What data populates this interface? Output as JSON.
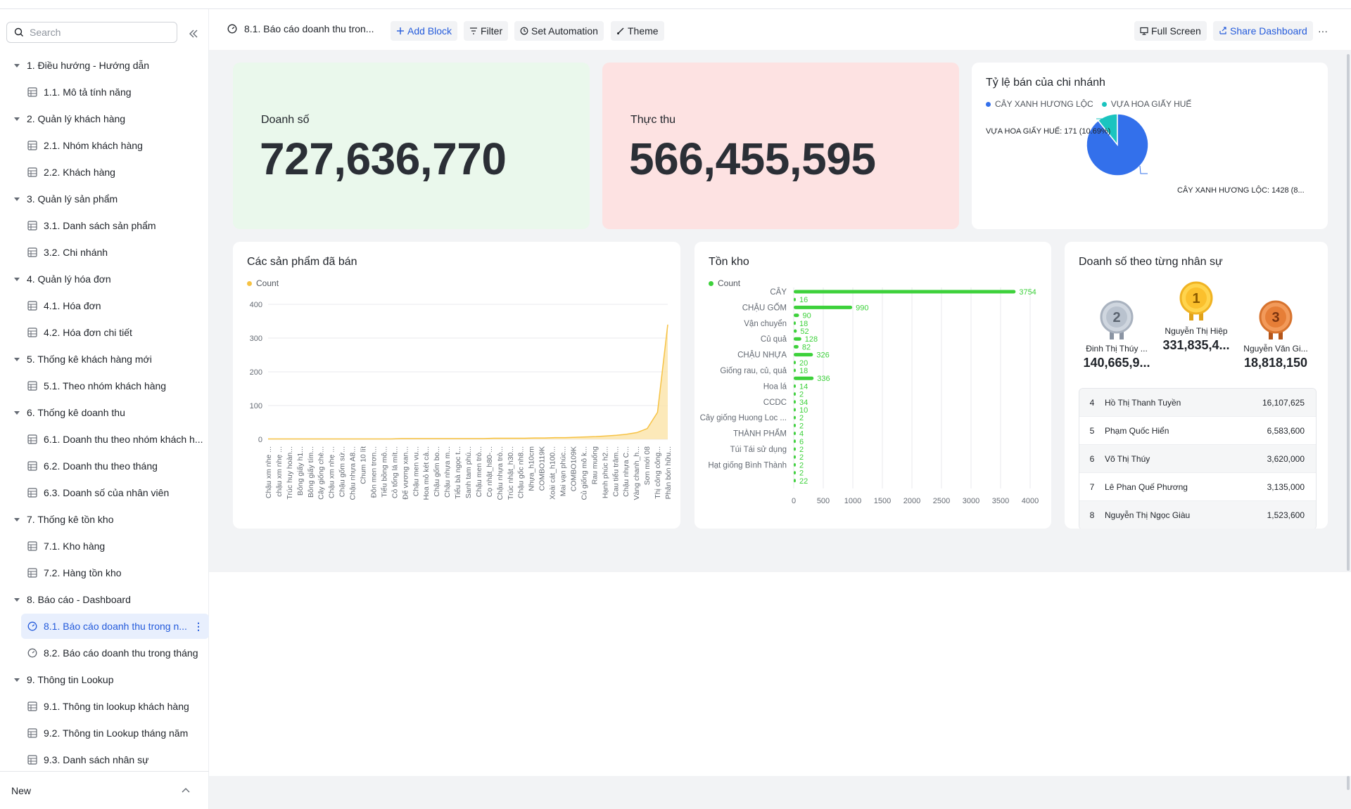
{
  "sidebar": {
    "search_placeholder": "Search",
    "groups": [
      {
        "label": "1. Điều hướng - Hướng dẫn"
      },
      {
        "label": "2. Quản lý khách hàng"
      },
      {
        "label": "3. Quản lý sản phẩm"
      },
      {
        "label": "4. Quản lý hóa đơn"
      },
      {
        "label": "5. Thống kê khách hàng mới"
      },
      {
        "label": "6. Thống kê doanh thu"
      },
      {
        "label": "7. Thống kê tồn kho"
      },
      {
        "label": "8. Báo cáo - Dashboard"
      },
      {
        "label": "9. Thông tin Lookup"
      }
    ],
    "items": [
      {
        "label": "1.1. Mô tả tính năng"
      },
      {
        "label": "2.1. Nhóm khách hàng"
      },
      {
        "label": "2.2. Khách hàng"
      },
      {
        "label": "3.1. Danh sách sản phẩm"
      },
      {
        "label": "3.2. Chi nhánh"
      },
      {
        "label": "4.1. Hóa đơn"
      },
      {
        "label": "4.2. Hóa đơn chi tiết"
      },
      {
        "label": "5.1. Theo nhóm khách hàng"
      },
      {
        "label": "6.1. Doanh thu theo nhóm khách h..."
      },
      {
        "label": "6.2. Doanh thu theo tháng"
      },
      {
        "label": "6.3. Doanh số của nhân viên"
      },
      {
        "label": "7.1. Kho hàng"
      },
      {
        "label": "7.2. Hàng tồn kho"
      },
      {
        "label": "8.1. Báo cáo doanh thu trong n..."
      },
      {
        "label": "8.2. Báo cáo doanh thu trong tháng"
      },
      {
        "label": "9.1. Thông tin lookup khách hàng"
      },
      {
        "label": "9.2. Thông tin Lookup tháng năm"
      },
      {
        "label": "9.3. Danh sách nhân sự"
      }
    ],
    "more_glyph": "⋮",
    "new_label": "New"
  },
  "toolbar": {
    "title": "8.1. Báo cáo doanh thu tron...",
    "add_block": "Add Block",
    "filter": "Filter",
    "set_automation": "Set Automation",
    "theme": "Theme",
    "full_screen": "Full Screen",
    "share_dashboard": "Share Dashboard",
    "more": "···"
  },
  "kpi": {
    "sales_label": "Doanh số",
    "sales_value": "727,636,770",
    "revenue_label": "Thực thu",
    "revenue_value": "566,455,595"
  },
  "colors": {
    "accent": "#245bdb",
    "kpi_green_bg": "#eaf8ec",
    "kpi_red_bg": "#fde2e2",
    "pie_blue": "#3370eb",
    "pie_teal": "#1bc4bf",
    "line_yellow": "#f6c244",
    "bar_green": "#3dd13b"
  },
  "pie": {
    "title": "Tỷ lệ bán của chi nhánh",
    "legend": [
      "CÂY XANH HƯƠNG LỘC",
      "VỰA HOA GIẤY HUẾ"
    ],
    "label_small": "VỰA HOA GIẤY HUẾ: 171 (10.69%)",
    "label_large": "CÂY XANH HƯƠNG LỘC: 1428 (8..."
  },
  "products_chart": {
    "title": "Các sản phẩm đã bán",
    "legend": "Count",
    "x_labels": [
      "Chậu xm nhe ...",
      "chậu xm nhẹ ...",
      "Trúc huy hoàn...",
      "Bông giấy h1...",
      "Bông giấy tím...",
      "Cây giống chè...",
      "Chậu xm nhẹ ...",
      "Chậu gốm sứ...",
      "Chậu nhựa A8...",
      "Chum 10 lít",
      "Đôn men trơn...",
      "Tiểu bồng mô...",
      "Cỏ tổng lá mít...",
      "Đế vương xan...",
      "Chậu men vu...",
      "Hoa mỏ két cả...",
      "Chậu gốm bo...",
      "Chậu nhựa m...",
      "Tiểu bà ngọc t...",
      "Sanh tam phú...",
      "Chậu men trò...",
      "Cọ nhật_h80-...",
      "Chậu nhựa trò...",
      "Trúc nhật_h30...",
      "Chậu gốc nh8...",
      "Nhựa_h10cm",
      "COMBO119K",
      "Xoài cát_h100...",
      "Mai vạn phúc...",
      "COMBO109K",
      "Củ giống mô k...",
      "Rau muống",
      "Hạnh phúc h2...",
      "Cau tiểu trâm...",
      "Chậu nhựa C...",
      "Vàng chanh_h...",
      "Sơn mới 08",
      "Thị công công...",
      "Phân bón hữu..."
    ]
  },
  "stock_chart": {
    "title": "Tồn kho",
    "legend": "Count",
    "x_ticks": [
      "0",
      "500",
      "1000",
      "1500",
      "2000",
      "2500",
      "3000",
      "3500",
      "4000"
    ]
  },
  "ranking": {
    "title": "Doanh số theo từng nhân sự",
    "top": [
      {
        "rank": "2",
        "name": "Đinh Thị Thúy ...",
        "value": "140,665,9..."
      },
      {
        "rank": "1",
        "name": "Nguyễn Thị Hiệp",
        "value": "331,835,4..."
      },
      {
        "rank": "3",
        "name": "Nguyễn Văn Gi...",
        "value": "18,818,150"
      }
    ],
    "rows": [
      {
        "no": "4",
        "name": "Hồ Thị Thanh Tuyền",
        "value": "16,107,625"
      },
      {
        "no": "5",
        "name": "Phạm Quốc Hiển",
        "value": "6,583,600"
      },
      {
        "no": "6",
        "name": "Võ Thị Thúy",
        "value": "3,620,000"
      },
      {
        "no": "7",
        "name": "Lê Phan Quế Phương",
        "value": "3,135,000"
      },
      {
        "no": "8",
        "name": "Nguyễn Thị Ngọc Giàu",
        "value": "1,523,600"
      }
    ]
  },
  "chart_data": [
    {
      "type": "pie",
      "title": "Tỷ lệ bán của chi nhánh",
      "legend_position": "top-left",
      "slices": [
        {
          "name": "CÂY XANH HƯƠNG LỘC",
          "value": 1428
        },
        {
          "name": "VỰA HOA GIẤY HUẾ",
          "value": 171
        }
      ]
    },
    {
      "type": "area",
      "title": "Các sản phẩm đã bán",
      "legend": [
        "Count"
      ],
      "y_ticks": [
        0,
        100,
        200,
        300,
        400
      ],
      "ylim": [
        0,
        400
      ],
      "grid": true,
      "series": [
        {
          "name": "Count",
          "values": [
            1,
            1,
            1,
            1,
            1,
            1,
            1,
            1,
            1,
            1,
            1,
            1,
            1,
            2,
            2,
            2,
            2,
            2,
            2,
            2,
            2,
            2,
            3,
            3,
            3,
            3,
            4,
            4,
            5,
            5,
            6,
            7,
            8,
            10,
            12,
            15,
            20,
            32,
            80,
            340
          ]
        }
      ]
    },
    {
      "type": "bar",
      "orientation": "horizontal",
      "title": "Tồn kho",
      "legend": [
        "Count"
      ],
      "xlim": [
        0,
        4000
      ],
      "grid": true,
      "categories": [
        "CÂY",
        "",
        "CHẬU GỐM",
        "",
        "Vận chuyển",
        "",
        "Củ quả",
        "",
        "CHẬU NHỰA",
        "",
        "Giống rau, củ, quả",
        "",
        "Hoa lá",
        "",
        "CCDC",
        "",
        "Cây giống Huong Loc ...",
        "",
        "THÀNH PHẨM",
        "",
        "Túi Tái sử dụng",
        "",
        "Hạt giống Bình Thành",
        "",
        ""
      ],
      "values": [
        3754,
        16,
        990,
        90,
        18,
        52,
        128,
        82,
        326,
        20,
        18,
        336,
        14,
        2,
        34,
        10,
        2,
        2,
        4,
        6,
        2,
        2,
        2,
        2,
        22
      ]
    }
  ]
}
